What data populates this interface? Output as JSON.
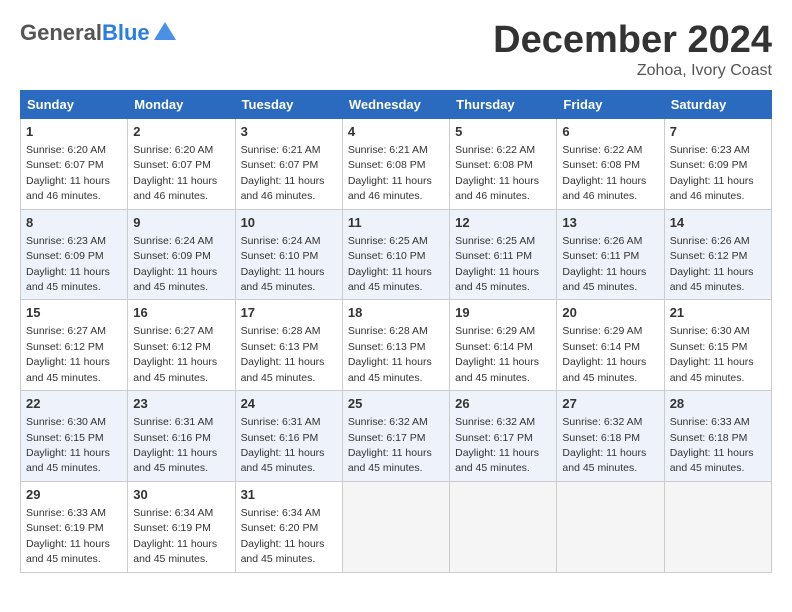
{
  "header": {
    "logo_general": "General",
    "logo_blue": "Blue",
    "title": "December 2024",
    "location": "Zohoa, Ivory Coast"
  },
  "columns": [
    "Sunday",
    "Monday",
    "Tuesday",
    "Wednesday",
    "Thursday",
    "Friday",
    "Saturday"
  ],
  "weeks": [
    [
      {
        "day": "1",
        "sunrise": "Sunrise: 6:20 AM",
        "sunset": "Sunset: 6:07 PM",
        "daylight": "Daylight: 11 hours and 46 minutes."
      },
      {
        "day": "2",
        "sunrise": "Sunrise: 6:20 AM",
        "sunset": "Sunset: 6:07 PM",
        "daylight": "Daylight: 11 hours and 46 minutes."
      },
      {
        "day": "3",
        "sunrise": "Sunrise: 6:21 AM",
        "sunset": "Sunset: 6:07 PM",
        "daylight": "Daylight: 11 hours and 46 minutes."
      },
      {
        "day": "4",
        "sunrise": "Sunrise: 6:21 AM",
        "sunset": "Sunset: 6:08 PM",
        "daylight": "Daylight: 11 hours and 46 minutes."
      },
      {
        "day": "5",
        "sunrise": "Sunrise: 6:22 AM",
        "sunset": "Sunset: 6:08 PM",
        "daylight": "Daylight: 11 hours and 46 minutes."
      },
      {
        "day": "6",
        "sunrise": "Sunrise: 6:22 AM",
        "sunset": "Sunset: 6:08 PM",
        "daylight": "Daylight: 11 hours and 46 minutes."
      },
      {
        "day": "7",
        "sunrise": "Sunrise: 6:23 AM",
        "sunset": "Sunset: 6:09 PM",
        "daylight": "Daylight: 11 hours and 46 minutes."
      }
    ],
    [
      {
        "day": "8",
        "sunrise": "Sunrise: 6:23 AM",
        "sunset": "Sunset: 6:09 PM",
        "daylight": "Daylight: 11 hours and 45 minutes."
      },
      {
        "day": "9",
        "sunrise": "Sunrise: 6:24 AM",
        "sunset": "Sunset: 6:09 PM",
        "daylight": "Daylight: 11 hours and 45 minutes."
      },
      {
        "day": "10",
        "sunrise": "Sunrise: 6:24 AM",
        "sunset": "Sunset: 6:10 PM",
        "daylight": "Daylight: 11 hours and 45 minutes."
      },
      {
        "day": "11",
        "sunrise": "Sunrise: 6:25 AM",
        "sunset": "Sunset: 6:10 PM",
        "daylight": "Daylight: 11 hours and 45 minutes."
      },
      {
        "day": "12",
        "sunrise": "Sunrise: 6:25 AM",
        "sunset": "Sunset: 6:11 PM",
        "daylight": "Daylight: 11 hours and 45 minutes."
      },
      {
        "day": "13",
        "sunrise": "Sunrise: 6:26 AM",
        "sunset": "Sunset: 6:11 PM",
        "daylight": "Daylight: 11 hours and 45 minutes."
      },
      {
        "day": "14",
        "sunrise": "Sunrise: 6:26 AM",
        "sunset": "Sunset: 6:12 PM",
        "daylight": "Daylight: 11 hours and 45 minutes."
      }
    ],
    [
      {
        "day": "15",
        "sunrise": "Sunrise: 6:27 AM",
        "sunset": "Sunset: 6:12 PM",
        "daylight": "Daylight: 11 hours and 45 minutes."
      },
      {
        "day": "16",
        "sunrise": "Sunrise: 6:27 AM",
        "sunset": "Sunset: 6:12 PM",
        "daylight": "Daylight: 11 hours and 45 minutes."
      },
      {
        "day": "17",
        "sunrise": "Sunrise: 6:28 AM",
        "sunset": "Sunset: 6:13 PM",
        "daylight": "Daylight: 11 hours and 45 minutes."
      },
      {
        "day": "18",
        "sunrise": "Sunrise: 6:28 AM",
        "sunset": "Sunset: 6:13 PM",
        "daylight": "Daylight: 11 hours and 45 minutes."
      },
      {
        "day": "19",
        "sunrise": "Sunrise: 6:29 AM",
        "sunset": "Sunset: 6:14 PM",
        "daylight": "Daylight: 11 hours and 45 minutes."
      },
      {
        "day": "20",
        "sunrise": "Sunrise: 6:29 AM",
        "sunset": "Sunset: 6:14 PM",
        "daylight": "Daylight: 11 hours and 45 minutes."
      },
      {
        "day": "21",
        "sunrise": "Sunrise: 6:30 AM",
        "sunset": "Sunset: 6:15 PM",
        "daylight": "Daylight: 11 hours and 45 minutes."
      }
    ],
    [
      {
        "day": "22",
        "sunrise": "Sunrise: 6:30 AM",
        "sunset": "Sunset: 6:15 PM",
        "daylight": "Daylight: 11 hours and 45 minutes."
      },
      {
        "day": "23",
        "sunrise": "Sunrise: 6:31 AM",
        "sunset": "Sunset: 6:16 PM",
        "daylight": "Daylight: 11 hours and 45 minutes."
      },
      {
        "day": "24",
        "sunrise": "Sunrise: 6:31 AM",
        "sunset": "Sunset: 6:16 PM",
        "daylight": "Daylight: 11 hours and 45 minutes."
      },
      {
        "day": "25",
        "sunrise": "Sunrise: 6:32 AM",
        "sunset": "Sunset: 6:17 PM",
        "daylight": "Daylight: 11 hours and 45 minutes."
      },
      {
        "day": "26",
        "sunrise": "Sunrise: 6:32 AM",
        "sunset": "Sunset: 6:17 PM",
        "daylight": "Daylight: 11 hours and 45 minutes."
      },
      {
        "day": "27",
        "sunrise": "Sunrise: 6:32 AM",
        "sunset": "Sunset: 6:18 PM",
        "daylight": "Daylight: 11 hours and 45 minutes."
      },
      {
        "day": "28",
        "sunrise": "Sunrise: 6:33 AM",
        "sunset": "Sunset: 6:18 PM",
        "daylight": "Daylight: 11 hours and 45 minutes."
      }
    ],
    [
      {
        "day": "29",
        "sunrise": "Sunrise: 6:33 AM",
        "sunset": "Sunset: 6:19 PM",
        "daylight": "Daylight: 11 hours and 45 minutes."
      },
      {
        "day": "30",
        "sunrise": "Sunrise: 6:34 AM",
        "sunset": "Sunset: 6:19 PM",
        "daylight": "Daylight: 11 hours and 45 minutes."
      },
      {
        "day": "31",
        "sunrise": "Sunrise: 6:34 AM",
        "sunset": "Sunset: 6:20 PM",
        "daylight": "Daylight: 11 hours and 45 minutes."
      },
      null,
      null,
      null,
      null
    ]
  ]
}
